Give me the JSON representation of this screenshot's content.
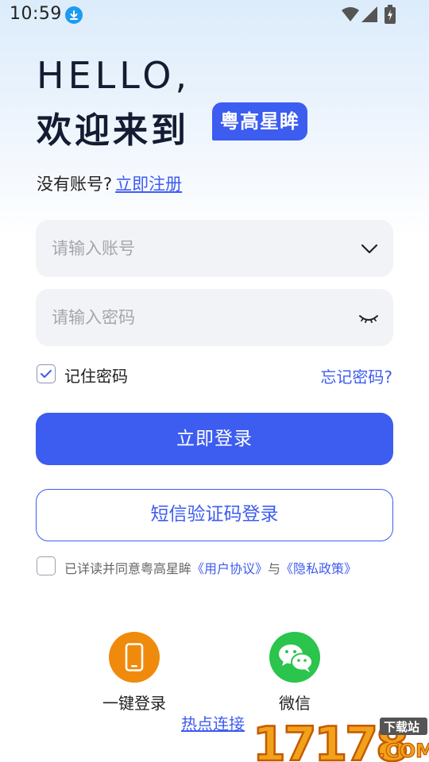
{
  "status_bar": {
    "time": "10:59"
  },
  "header": {
    "hello": "HELLO,",
    "welcome": "欢迎来到",
    "brand": "粤高星眸"
  },
  "register": {
    "prompt": "没有账号?",
    "link": "立即注册"
  },
  "account_field": {
    "placeholder": "请输入账号"
  },
  "password_field": {
    "placeholder": "请输入密码"
  },
  "remember": {
    "label": "记住密码",
    "checked": true
  },
  "forgot_label": "忘记密码?",
  "login_button": "立即登录",
  "sms_button": "短信验证码登录",
  "agreement": {
    "prefix": "已详读并同意粤高星眸",
    "user_agreement": "《用户协议》",
    "joiner": "与",
    "privacy_policy": "《隐私政策》"
  },
  "quick_login": [
    {
      "label": "一键登录",
      "icon": "phone-icon",
      "color": "#f08a0c"
    },
    {
      "label": "微信",
      "icon": "wechat-icon",
      "color": "#2bc44c"
    }
  ],
  "hotspot_link": "热点连接",
  "watermark": {
    "number": "17178",
    "tag": "下载站",
    "domain": ".COM"
  },
  "colors": {
    "accent": "#3d5cf0",
    "field_bg": "#f2f3f6"
  }
}
